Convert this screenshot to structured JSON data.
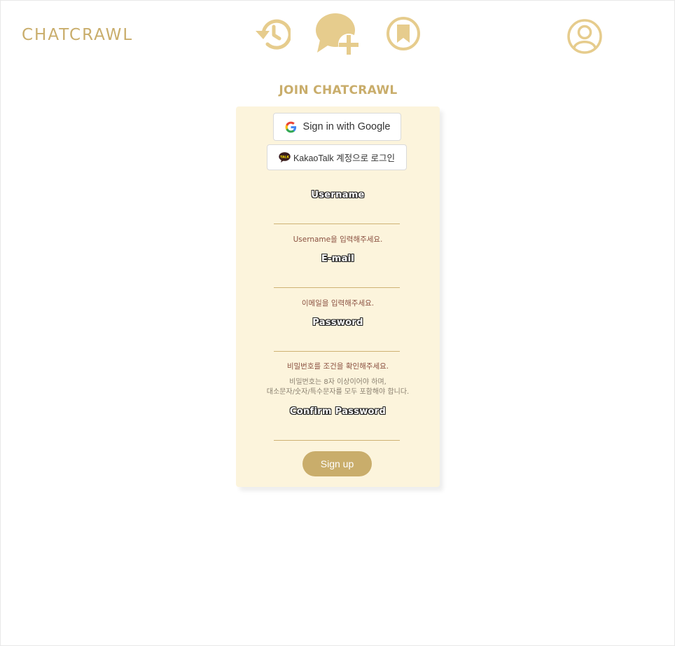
{
  "header": {
    "logo": "CHATCRAWL",
    "icons": [
      "history-icon",
      "new-chat-icon",
      "bookmark-icon",
      "profile-icon"
    ]
  },
  "page_title": "JOIN CHATCRAWL",
  "oauth": {
    "google_label": "Sign in with Google",
    "kakao_label": "KakaoTalk 계정으로 로그인",
    "kakao_badge": "TALK"
  },
  "form": {
    "username": {
      "label": "Username",
      "value": "",
      "error": "Username을 입력해주세요."
    },
    "email": {
      "label": "E-mail",
      "value": "",
      "error": "이메일을 입력해주세요."
    },
    "password": {
      "label": "Password",
      "value": "",
      "error": "비밀번호를 조건을 확인해주세요.",
      "hint_line1": "비밀번호는 8자 이상이어야 하며,",
      "hint_line2": "대소문자/숫자/특수문자를 모두 포함해야 합니다."
    },
    "confirm_password": {
      "label": "Confirm Password",
      "value": ""
    },
    "submit_label": "Sign up"
  },
  "colors": {
    "accent": "#c9ad6b",
    "icon": "#e6cc8d",
    "card_bg": "#fcf4dc",
    "error": "#8a5040"
  }
}
